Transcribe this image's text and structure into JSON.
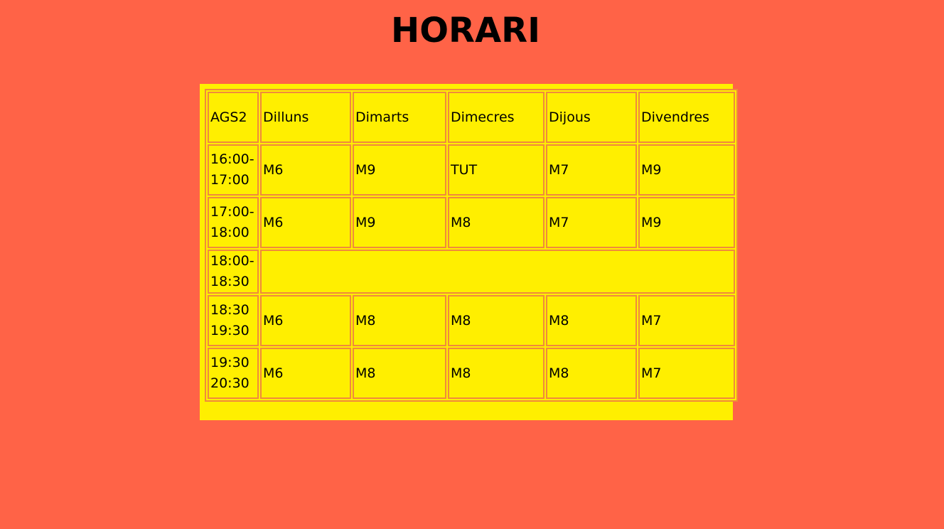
{
  "title": "HORARI",
  "colors": {
    "background": "#ff6347",
    "table_fill": "#ffef00",
    "cell_border": "#f08a3c",
    "text": "#000000"
  },
  "table": {
    "corner": "AGS2",
    "days": [
      "Dilluns",
      "Dimarts",
      "Dimecres",
      "Dijous",
      "Divendres"
    ],
    "rows": [
      {
        "time_start": "16:00-",
        "time_end": "17:00",
        "cells": [
          "M6",
          "M9",
          "TUT",
          "M7",
          "M9"
        ]
      },
      {
        "time_start": "17:00-",
        "time_end": "18:00",
        "cells": [
          "M6",
          "M9",
          "M8",
          "M7",
          "M9"
        ]
      },
      {
        "time_start": "18:00-",
        "time_end": "18:30",
        "cells": []
      },
      {
        "time_start": "18:30",
        "time_end": "19:30",
        "cells": [
          "M6",
          "M8",
          "M8",
          "M8",
          "M7"
        ]
      },
      {
        "time_start": "19:30",
        "time_end": "20:30",
        "cells": [
          "M6",
          "M8",
          "M8",
          "M8",
          "M7"
        ]
      }
    ]
  }
}
